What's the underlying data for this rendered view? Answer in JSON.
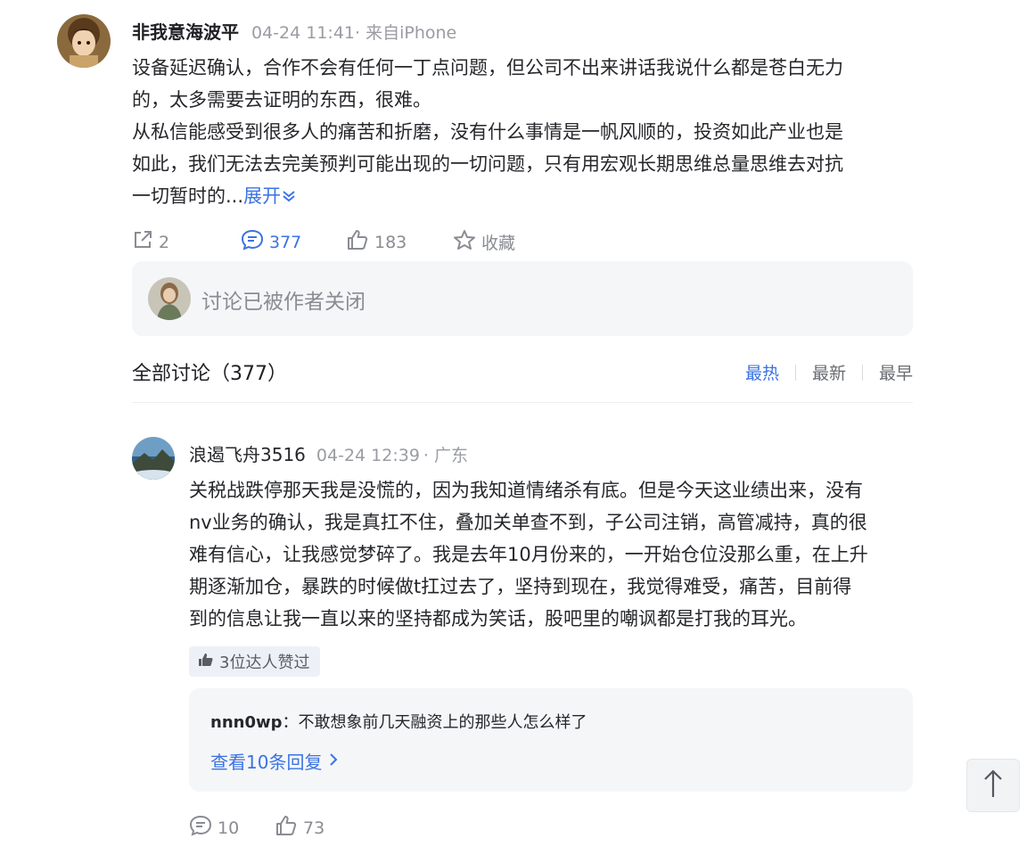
{
  "post": {
    "author": "非我意海波平",
    "time": "04-24 11:41",
    "source": "· 来自iPhone",
    "lines": [
      "设备延迟确认，合作不会有任何一丁点问题，但公司不出来讲话我说什么都是苍白无力",
      "的，太多需要去证明的东西，很难。",
      "从私信能感受到很多人的痛苦和折磨，没有什么事情是一帆风顺的，投资如此产业也是",
      "如此，我们无法去完美预判可能出现的一切问题，只有用宏观长期思维总量思维去对抗",
      "一切暂时的..."
    ],
    "expand_label": "展开",
    "actions": {
      "share_count": "2",
      "comment_count": "377",
      "like_count": "183",
      "favorite_label": "收藏"
    }
  },
  "discussion": {
    "closed_text": "讨论已被作者关闭",
    "header": "全部讨论（377）",
    "sort_options": [
      "最热",
      "最新",
      "最早"
    ],
    "active_sort": "最热"
  },
  "comment": {
    "author": "浪遏飞舟3516",
    "time": "04-24 12:39",
    "location": "· 广东",
    "lines": [
      "关税战跌停那天我是没慌的，因为我知道情绪杀有底。但是今天这业绩出来，没有",
      "nv业务的确认，我是真扛不住，叠加关单查不到，子公司注销，高管减持，真的很",
      "难有信心，让我感觉梦碎了。我是去年10月份来的，一开始仓位没那么重，在上升",
      "期逐渐加仓，暴跌的时候做t扛过去了，坚持到现在，我觉得难受，痛苦，目前得",
      "到的信息让我一直以来的坚持都成为笑话，股吧里的嘲讽都是打我的耳光。"
    ],
    "badge": "3位达人赞过",
    "reply": {
      "user": "nnn0wp",
      "colon": "：",
      "text": "不敢想象前几天融资上的那些人怎么样了",
      "view_more": "查看10条回复"
    },
    "comment_count": "10",
    "like_count": "73"
  },
  "icons": {
    "share": "share-icon",
    "comment": "comment-icon",
    "like": "thumbs-up-icon",
    "favorite": "star-icon",
    "back_to_top": "arrow-up-icon"
  },
  "colors": {
    "accent": "#3b73e3",
    "muted": "#9a9ca3",
    "panel": "#f5f6f8"
  }
}
